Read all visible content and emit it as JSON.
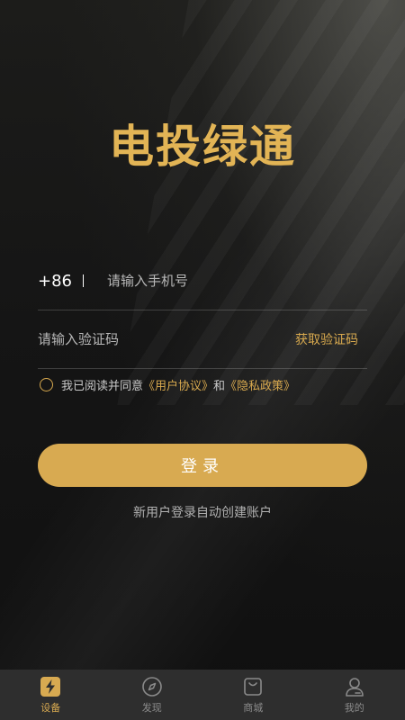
{
  "app": {
    "title": "电投绿通"
  },
  "login": {
    "country_code": "+86",
    "phone_placeholder": "请输入手机号",
    "code_placeholder": "请输入验证码",
    "get_code_label": "获取验证码",
    "agreement": {
      "prefix": "我已阅读并同意",
      "user_agreement": "《用户协议》",
      "and": "和",
      "privacy_policy": "《隐私政策》",
      "checked": false
    },
    "submit_label": "登录",
    "hint": "新用户登录自动创建账户"
  },
  "tabbar": {
    "active": "设备",
    "tabs": [
      {
        "label": "设备",
        "icon": "lightning-icon"
      },
      {
        "label": "发现",
        "icon": "compass-icon"
      },
      {
        "label": "商城",
        "icon": "shopping-bag-icon"
      },
      {
        "label": "我的",
        "icon": "user-icon"
      }
    ]
  },
  "colors": {
    "accent": "#d8aa51",
    "title": "#e2b455",
    "tabbar_bg": "#2e2e2e",
    "inactive": "#8a8a8a"
  }
}
